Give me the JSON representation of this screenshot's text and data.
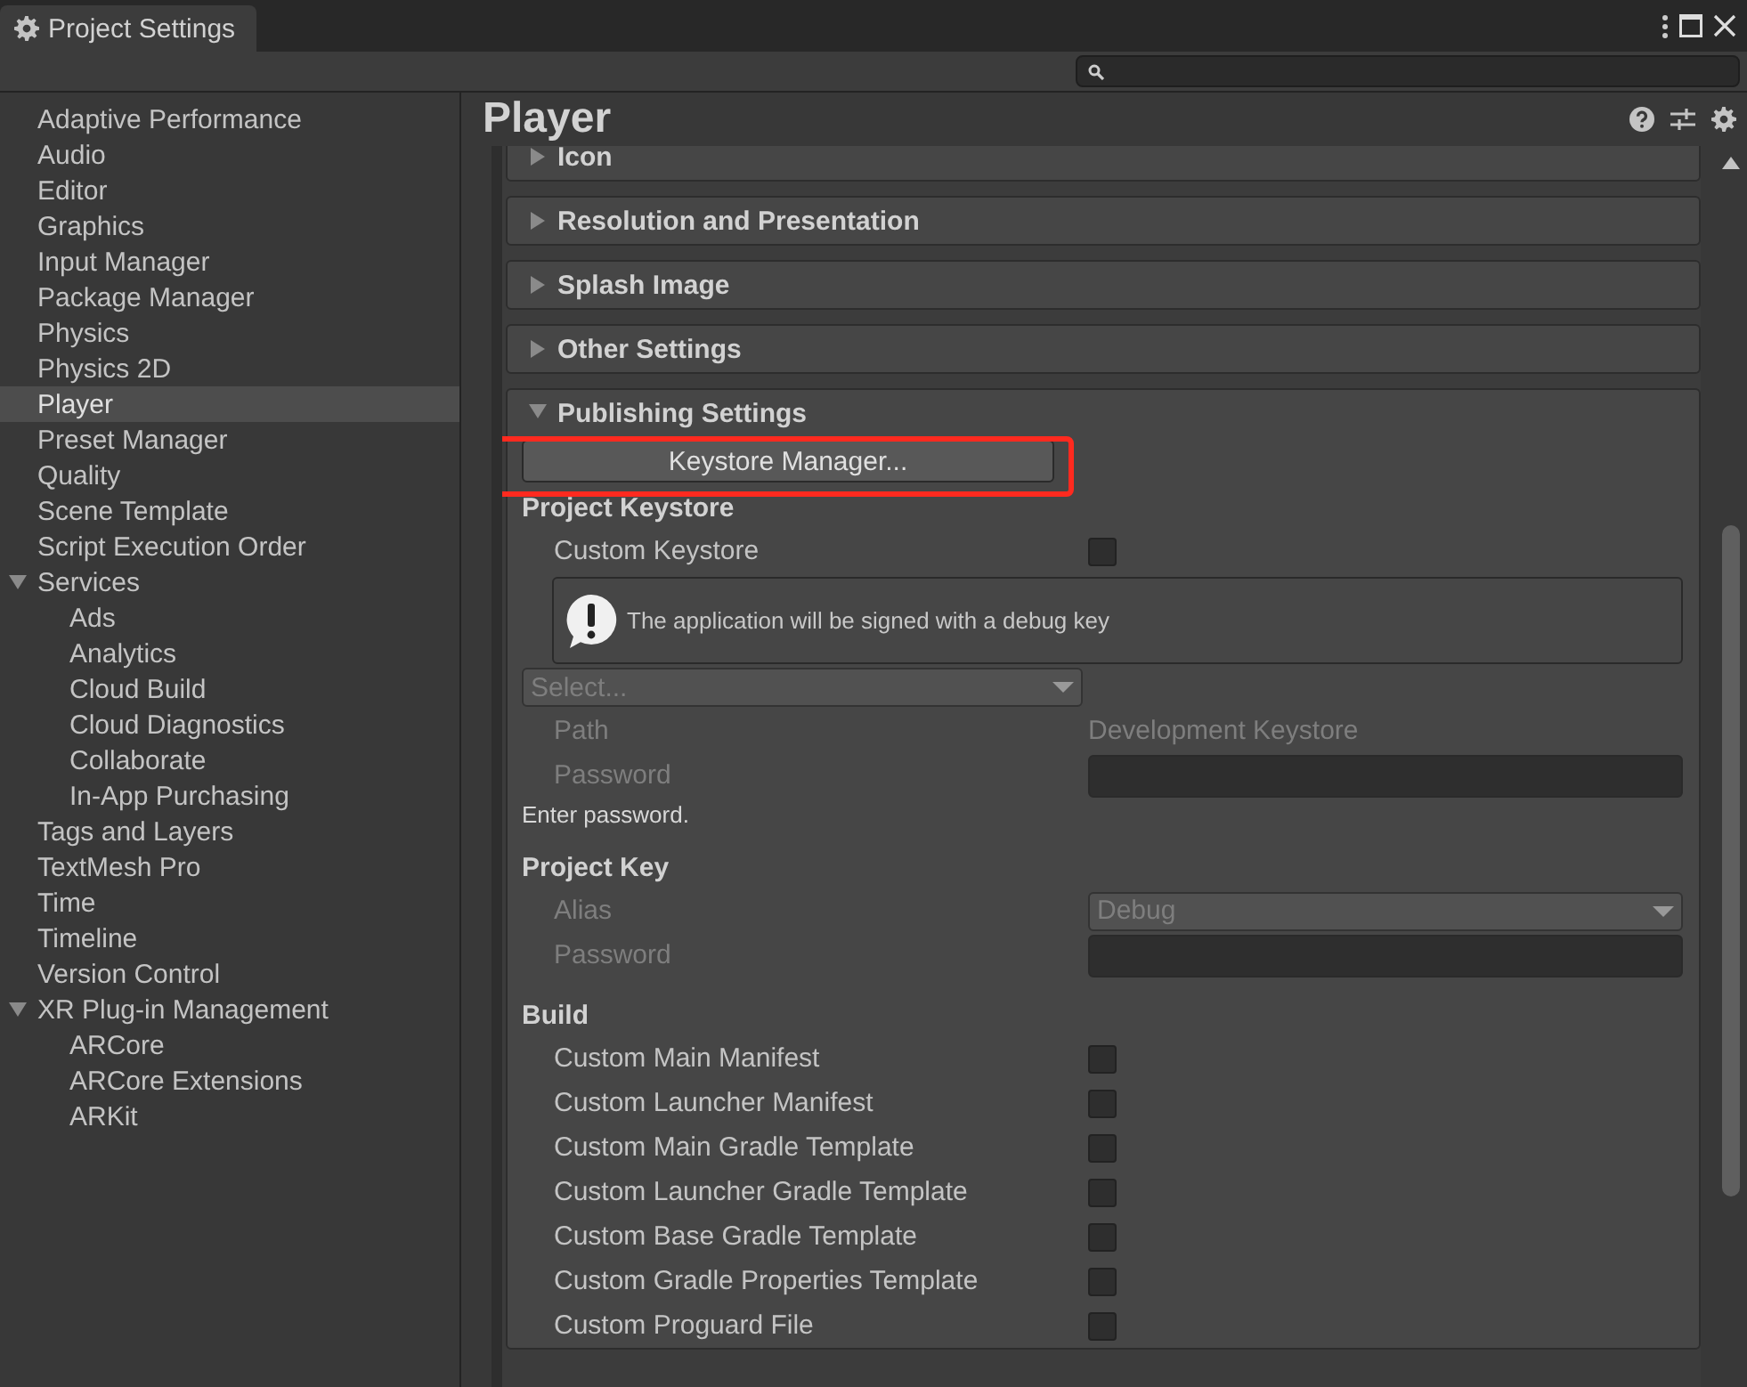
{
  "window": {
    "title": "Project Settings"
  },
  "sidebar": {
    "items": [
      {
        "label": "Adaptive Performance",
        "selected": false
      },
      {
        "label": "Audio",
        "selected": false
      },
      {
        "label": "Editor",
        "selected": false
      },
      {
        "label": "Graphics",
        "selected": false
      },
      {
        "label": "Input Manager",
        "selected": false
      },
      {
        "label": "Package Manager",
        "selected": false
      },
      {
        "label": "Physics",
        "selected": false
      },
      {
        "label": "Physics 2D",
        "selected": false
      },
      {
        "label": "Player",
        "selected": true
      },
      {
        "label": "Preset Manager",
        "selected": false
      },
      {
        "label": "Quality",
        "selected": false
      },
      {
        "label": "Scene Template",
        "selected": false
      },
      {
        "label": "Script Execution Order",
        "selected": false
      },
      {
        "label": "Services",
        "selected": false,
        "expanded": true,
        "children": [
          {
            "label": "Ads",
            "selected": false
          },
          {
            "label": "Analytics",
            "selected": false
          },
          {
            "label": "Cloud Build",
            "selected": false
          },
          {
            "label": "Cloud Diagnostics",
            "selected": false
          },
          {
            "label": "Collaborate",
            "selected": false
          },
          {
            "label": "In-App Purchasing",
            "selected": false
          }
        ]
      },
      {
        "label": "Tags and Layers",
        "selected": false
      },
      {
        "label": "TextMesh Pro",
        "selected": false
      },
      {
        "label": "Time",
        "selected": false
      },
      {
        "label": "Timeline",
        "selected": false
      },
      {
        "label": "Version Control",
        "selected": false
      },
      {
        "label": "XR Plug-in Management",
        "selected": false,
        "expanded": true,
        "children": [
          {
            "label": "ARCore",
            "selected": false
          },
          {
            "label": "ARCore Extensions",
            "selected": false
          },
          {
            "label": "ARKit",
            "selected": false
          }
        ]
      }
    ]
  },
  "page": {
    "title": "Player",
    "sections": [
      {
        "title": "Icon",
        "expanded": false
      },
      {
        "title": "Resolution and Presentation",
        "expanded": false
      },
      {
        "title": "Splash Image",
        "expanded": false
      },
      {
        "title": "Other Settings",
        "expanded": false
      },
      {
        "title": "Publishing Settings",
        "expanded": true,
        "rows": [
          {
            "kind": "button",
            "label": "Keystore Manager..."
          },
          {
            "kind": "heading",
            "label": "Project Keystore"
          },
          {
            "kind": "checkbox",
            "label": "Custom Keystore",
            "checked": false
          },
          {
            "kind": "helpbox",
            "text": "The application will be signed with a debug key"
          },
          {
            "kind": "dropdown",
            "value": "Select...",
            "disabled": true
          },
          {
            "kind": "value",
            "label": "Path",
            "value": "Development Keystore",
            "disabled": true
          },
          {
            "kind": "field",
            "label": "Password",
            "disabled": true
          },
          {
            "kind": "note",
            "text": "Enter password."
          },
          {
            "kind": "heading",
            "label": "Project Key"
          },
          {
            "kind": "select",
            "label": "Alias",
            "value": "Debug",
            "disabled": true
          },
          {
            "kind": "field",
            "label": "Password",
            "disabled": true
          },
          {
            "kind": "heading",
            "label": "Build"
          },
          {
            "kind": "checkbox",
            "label": "Custom Main Manifest",
            "checked": false
          },
          {
            "kind": "checkbox",
            "label": "Custom Launcher Manifest",
            "checked": false
          },
          {
            "kind": "checkbox",
            "label": "Custom Main Gradle Template",
            "checked": false
          },
          {
            "kind": "checkbox",
            "label": "Custom Launcher Gradle Template",
            "checked": false
          },
          {
            "kind": "checkbox",
            "label": "Custom Base Gradle Template",
            "checked": false
          },
          {
            "kind": "checkbox",
            "label": "Custom Gradle Properties Template",
            "checked": false
          },
          {
            "kind": "checkbox",
            "label": "Custom Proguard File",
            "checked": false
          }
        ]
      }
    ]
  }
}
